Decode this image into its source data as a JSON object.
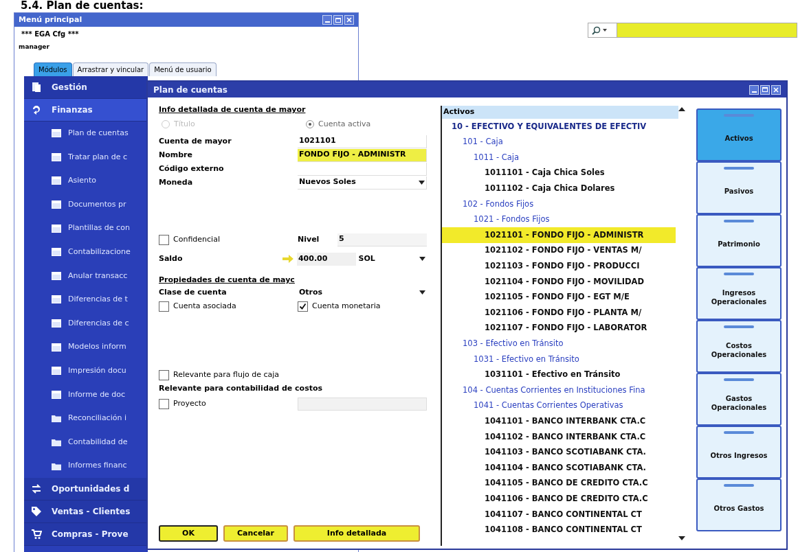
{
  "heading": "5.4. Plan de cuentas:",
  "main_menu": {
    "title": "Menú principal",
    "company": "*** EGA Cfg ***",
    "user": "manager",
    "tabs": [
      {
        "label": "Módulos",
        "selected": true
      },
      {
        "label": "Arrastrar y vincular",
        "selected": false
      },
      {
        "label": "Menú de usuario",
        "selected": false
      }
    ],
    "modules": [
      {
        "label": "Gestión",
        "kind": "gestion",
        "expanded": false
      },
      {
        "label": "Finanzas",
        "kind": "finanzas",
        "expanded": true,
        "children": [
          {
            "label": "Plan de cuentas",
            "kind": "form"
          },
          {
            "label": "Tratar plan de c",
            "kind": "form"
          },
          {
            "label": "Asiento",
            "kind": "form"
          },
          {
            "label": "Documentos pr",
            "kind": "form"
          },
          {
            "label": "Plantillas de con",
            "kind": "form"
          },
          {
            "label": "Contabilizacione",
            "kind": "form"
          },
          {
            "label": "Anular transacc",
            "kind": "form"
          },
          {
            "label": "Diferencias de t",
            "kind": "form"
          },
          {
            "label": "Diferencias de c",
            "kind": "form"
          },
          {
            "label": "Modelos inform",
            "kind": "form"
          },
          {
            "label": "Impresión docu",
            "kind": "form"
          },
          {
            "label": "Informe de doc",
            "kind": "form"
          },
          {
            "label": "Reconciliación i",
            "kind": "folder"
          },
          {
            "label": "Contabilidad de",
            "kind": "folder"
          },
          {
            "label": "Informes financ",
            "kind": "folder"
          }
        ]
      },
      {
        "label": "Oportunidades d",
        "kind": "oportunidades",
        "expanded": false
      },
      {
        "label": "Ventas - Clientes",
        "kind": "ventas",
        "expanded": false
      },
      {
        "label": "Compras - Prove",
        "kind": "compras",
        "expanded": false
      }
    ]
  },
  "plan_window": {
    "title": "Plan de cuentas",
    "section_title": "Info detallada de cuenta de mayor",
    "radios": [
      {
        "label": "Título",
        "selected": false,
        "disabled": true
      },
      {
        "label": "Cuenta activa",
        "selected": true,
        "disabled": false
      }
    ],
    "fields": [
      {
        "label": "Cuenta de mayor",
        "value": "1021101",
        "kind": "text",
        "highlighted": false
      },
      {
        "label": "Nombre",
        "value": "FONDO FIJO - ADMINISTR",
        "kind": "text",
        "highlighted": true
      },
      {
        "label": "Código externo",
        "kind": "text",
        "highlighted": false
      },
      {
        "label": "Moneda",
        "value": "Nuevos Soles",
        "kind": "select",
        "highlighted": false
      }
    ],
    "confidencial": {
      "label": "Confidencial",
      "checked": false
    },
    "nivel": {
      "label": "Nivel",
      "value": "5"
    },
    "saldo": {
      "label": "Saldo",
      "value": "400.00",
      "currency": "SOL"
    },
    "properties_title": "Propiedades de cuenta de mayc",
    "clase": {
      "label": "Clase de cuenta",
      "value": "Otros"
    },
    "cuenta_asociada": {
      "label": "Cuenta asociada",
      "checked": false
    },
    "cuenta_monetaria": {
      "label": "Cuenta monetaria",
      "checked": true
    },
    "flujo_caja": {
      "label": "Relevante para flujo de caja",
      "checked": false
    },
    "costos_label": "Relevante para contabilidad de costos",
    "proyecto": {
      "label": "Proyecto",
      "checked": false
    },
    "buttons": [
      "OK",
      "Cancelar",
      "Info detallada"
    ],
    "tree": {
      "header": "Activos",
      "items": [
        {
          "label": "10 - EFECTIVO Y EQUIVALENTES DE EFECTIV",
          "kind": "title",
          "selected": false,
          "children": [
            {
              "label": "101 - Caja",
              "kind": "title",
              "selected": false,
              "children": [
                {
                  "label": "1011 - Caja",
                  "kind": "title",
                  "selected": false,
                  "children": [
                    {
                      "label": "1011101 - Caja Chica Soles",
                      "kind": "account",
                      "selected": false
                    },
                    {
                      "label": "1011102 - Caja Chica Dolares",
                      "kind": "account",
                      "selected": false
                    }
                  ]
                }
              ]
            },
            {
              "label": "102 - Fondos Fijos",
              "kind": "title",
              "selected": false,
              "children": [
                {
                  "label": "1021 - Fondos Fijos",
                  "kind": "title",
                  "selected": false,
                  "children": [
                    {
                      "label": "1021101 - FONDO FIJO - ADMINISTR",
                      "kind": "account",
                      "selected": true
                    },
                    {
                      "label": "1021102 - FONDO FIJO - VENTAS M/",
                      "kind": "account",
                      "selected": false
                    },
                    {
                      "label": "1021103 - FONDO FIJO - PRODUCCI",
                      "kind": "account",
                      "selected": false
                    },
                    {
                      "label": "1021104 - FONDO FIJO - MOVILIDAD",
                      "kind": "account",
                      "selected": false
                    },
                    {
                      "label": "1021105 - FONDO FIJO - EGT M/E",
                      "kind": "account",
                      "selected": false
                    },
                    {
                      "label": "1021106 - FONDO FIJO - PLANTA M/",
                      "kind": "account",
                      "selected": false
                    },
                    {
                      "label": "1021107 - FONDO FIJO - LABORATOR",
                      "kind": "account",
                      "selected": false
                    }
                  ]
                }
              ]
            },
            {
              "label": "103 - Efectivo en Tránsito",
              "kind": "title",
              "selected": false,
              "children": [
                {
                  "label": "1031 - Efectivo en Tránsito",
                  "kind": "title",
                  "selected": false,
                  "children": [
                    {
                      "label": "1031101 - Efectivo en Tránsito",
                      "kind": "account",
                      "selected": false
                    }
                  ]
                }
              ]
            },
            {
              "label": "104 - Cuentas Corrientes en Instituciones Fina",
              "kind": "title",
              "selected": false,
              "children": [
                {
                  "label": "1041 - Cuentas Corrientes Operativas",
                  "kind": "title",
                  "selected": false,
                  "children": [
                    {
                      "label": "1041101 - BANCO INTERBANK CTA.C",
                      "kind": "account",
                      "selected": false
                    },
                    {
                      "label": "1041102 - BANCO INTERBANK CTA.C",
                      "kind": "account",
                      "selected": false
                    },
                    {
                      "label": "1041103 - BANCO SCOTIABANK CTA.",
                      "kind": "account",
                      "selected": false
                    },
                    {
                      "label": "1041104 - BANCO SCOTIABANK CTA.",
                      "kind": "account",
                      "selected": false
                    },
                    {
                      "label": "1041105 - BANCO DE CREDITO CTA.C",
                      "kind": "account",
                      "selected": false
                    },
                    {
                      "label": "1041106 - BANCO DE CREDITO CTA.C",
                      "kind": "account",
                      "selected": false
                    },
                    {
                      "label": "1041107 - BANCO CONTINENTAL  CT",
                      "kind": "account",
                      "selected": false
                    },
                    {
                      "label": "1041108 - BANCO CONTINENTAL  CT",
                      "kind": "account",
                      "selected": false
                    }
                  ]
                }
              ]
            }
          ]
        }
      ]
    },
    "drawers": [
      {
        "label": "Activos",
        "selected": true
      },
      {
        "label": "Pasivos",
        "selected": false
      },
      {
        "label": "Patrimonio",
        "selected": false
      },
      {
        "label": "Ingresos Operacionales",
        "selected": false
      },
      {
        "label": "Costos Operacionales",
        "selected": false
      },
      {
        "label": "Gastos Operacionales",
        "selected": false
      },
      {
        "label": "Otros Ingresos",
        "selected": false
      },
      {
        "label": "Otros Gastos",
        "selected": false
      }
    ]
  }
}
